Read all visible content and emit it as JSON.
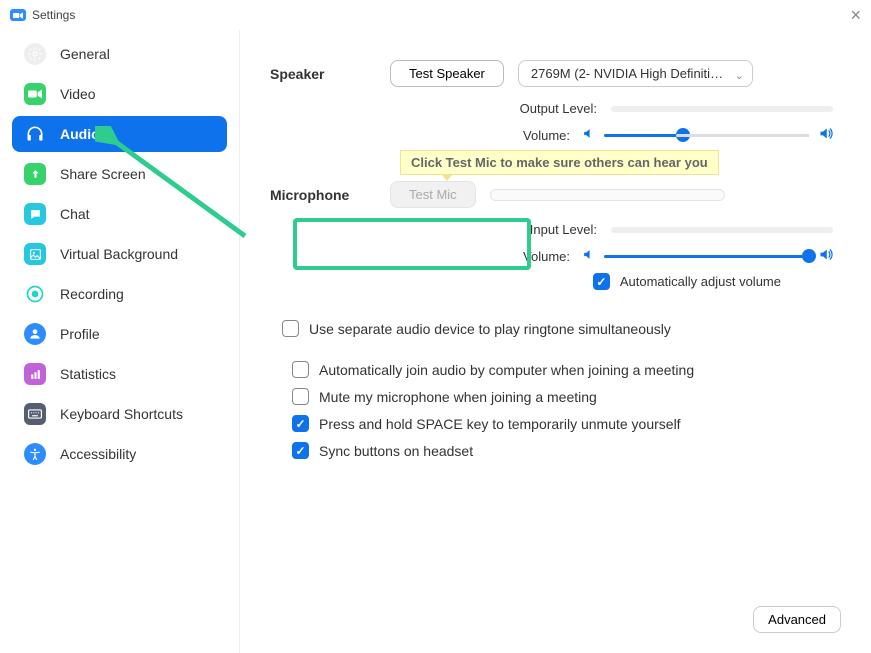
{
  "window": {
    "title": "Settings"
  },
  "sidebar": {
    "items": [
      {
        "key": "general",
        "label": "General",
        "active": false
      },
      {
        "key": "video",
        "label": "Video",
        "active": false
      },
      {
        "key": "audio",
        "label": "Audio",
        "active": true
      },
      {
        "key": "share-screen",
        "label": "Share Screen",
        "active": false
      },
      {
        "key": "chat",
        "label": "Chat",
        "active": false
      },
      {
        "key": "virtual-background",
        "label": "Virtual Background",
        "active": false
      },
      {
        "key": "recording",
        "label": "Recording",
        "active": false
      },
      {
        "key": "profile",
        "label": "Profile",
        "active": false
      },
      {
        "key": "statistics",
        "label": "Statistics",
        "active": false
      },
      {
        "key": "keyboard-shortcuts",
        "label": "Keyboard Shortcuts",
        "active": false
      },
      {
        "key": "accessibility",
        "label": "Accessibility",
        "active": false
      }
    ]
  },
  "audio": {
    "speaker": {
      "label": "Speaker",
      "test_btn": "Test Speaker",
      "device": "2769M (2- NVIDIA High Definitio...",
      "output_level_label": "Output Level:",
      "volume_label": "Volume:",
      "volume_pct": 35
    },
    "tooltip": "Click Test Mic to make sure others can hear you",
    "microphone": {
      "label": "Microphone",
      "test_btn": "Test Mic",
      "device": "",
      "input_level_label": "Input Level:",
      "volume_label": "Volume:",
      "volume_pct": 100,
      "auto_adjust_label": "Automatically adjust volume",
      "auto_adjust": true
    },
    "options": [
      {
        "key": "separate-ringtone",
        "label": "Use separate audio device to play ringtone simultaneously",
        "checked": false
      },
      {
        "key": "auto-join",
        "label": "Automatically join audio by computer when joining a meeting",
        "checked": false
      },
      {
        "key": "mute-on-join",
        "label": "Mute my microphone when joining a meeting",
        "checked": false
      },
      {
        "key": "space-unmute",
        "label": "Press and hold SPACE key to temporarily unmute yourself",
        "checked": true
      },
      {
        "key": "sync-headset",
        "label": "Sync buttons on headset",
        "checked": true
      }
    ],
    "advanced_btn": "Advanced"
  },
  "annotations": {
    "arrow_color": "#2ecc8f",
    "highlight_target": "microphone-section"
  }
}
